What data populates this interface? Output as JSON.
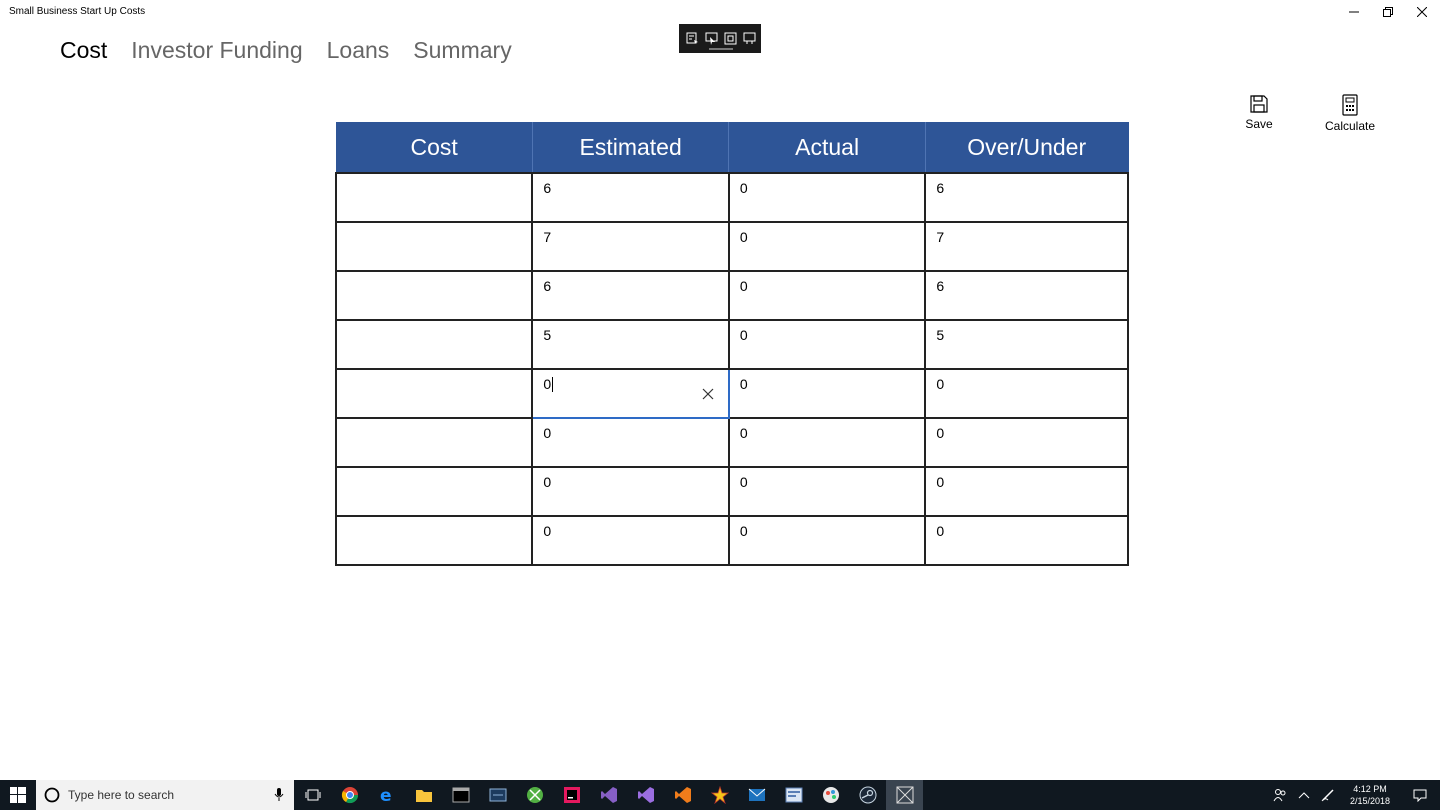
{
  "window": {
    "title": "Small Business Start Up Costs"
  },
  "tabs": [
    {
      "label": "Cost"
    },
    {
      "label": "Investor Funding"
    },
    {
      "label": "Loans"
    },
    {
      "label": "Summary"
    }
  ],
  "commands": {
    "save_label": "Save",
    "calculate_label": "Calculate"
  },
  "table": {
    "headers": [
      "Cost",
      "Estimated",
      "Actual",
      "Over/Under"
    ],
    "rows": [
      {
        "cost": "",
        "estimated": "6",
        "actual": "0",
        "over_under": "6"
      },
      {
        "cost": "",
        "estimated": "7",
        "actual": "0",
        "over_under": "7"
      },
      {
        "cost": "",
        "estimated": "6",
        "actual": "0",
        "over_under": "6"
      },
      {
        "cost": "",
        "estimated": "5",
        "actual": "0",
        "over_under": "5"
      },
      {
        "cost": "",
        "estimated": "0",
        "actual": "0",
        "over_under": "0"
      },
      {
        "cost": "",
        "estimated": "0",
        "actual": "0",
        "over_under": "0"
      },
      {
        "cost": "",
        "estimated": "0",
        "actual": "0",
        "over_under": "0"
      },
      {
        "cost": "",
        "estimated": "0",
        "actual": "0",
        "over_under": "0"
      }
    ]
  },
  "taskbar": {
    "search_placeholder": "Type here to search",
    "time": "4:12 PM",
    "date": "2/15/2018"
  },
  "colors": {
    "header_bg": "#2e5597",
    "focus_border": "#2e6bc6",
    "taskbar_bg": "#101820"
  }
}
